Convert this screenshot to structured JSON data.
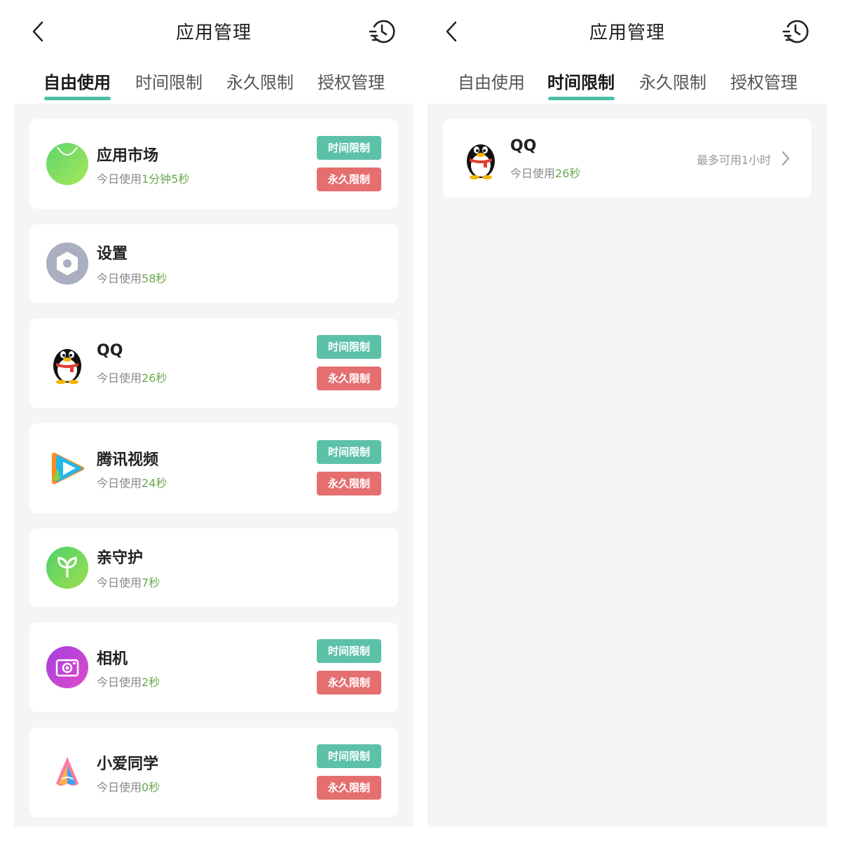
{
  "left": {
    "title": "应用管理",
    "tabs": [
      "自由使用",
      "时间限制",
      "永久限制",
      "授权管理"
    ],
    "active_tab": "自由使用",
    "usage_prefix": "今日使用",
    "buttons": {
      "time": "时间限制",
      "perm": "永久限制"
    },
    "apps": [
      {
        "name": "应用市场",
        "usage": "1分钟5秒",
        "icon": "app-market-icon"
      },
      {
        "name": "设置",
        "usage": "58秒",
        "icon": "settings-icon"
      },
      {
        "name": "QQ",
        "usage": "26秒",
        "icon": "qq-penguin-icon"
      },
      {
        "name": "腾讯视频",
        "usage": "24秒",
        "icon": "tencent-video-icon"
      },
      {
        "name": "亲守护",
        "usage": "7秒",
        "icon": "parental-guard-icon"
      },
      {
        "name": "相机",
        "usage": "2秒",
        "icon": "camera-icon"
      },
      {
        "name": "小爱同学",
        "usage": "0秒",
        "icon": "xiaoai-icon"
      }
    ]
  },
  "right": {
    "title": "应用管理",
    "tabs": [
      "自由使用",
      "时间限制",
      "永久限制",
      "授权管理"
    ],
    "active_tab": "时间限制",
    "usage_prefix": "今日使用",
    "apps": [
      {
        "name": "QQ",
        "usage": "26秒",
        "limit": "最多可用1小时",
        "icon": "qq-penguin-icon"
      }
    ]
  },
  "colors": {
    "accent": "#4dbfa9",
    "time_button": "#5cc1a8",
    "perm_button": "#e56f6f",
    "usage_value": "#6aa84f",
    "background": "#f5f5f5"
  }
}
